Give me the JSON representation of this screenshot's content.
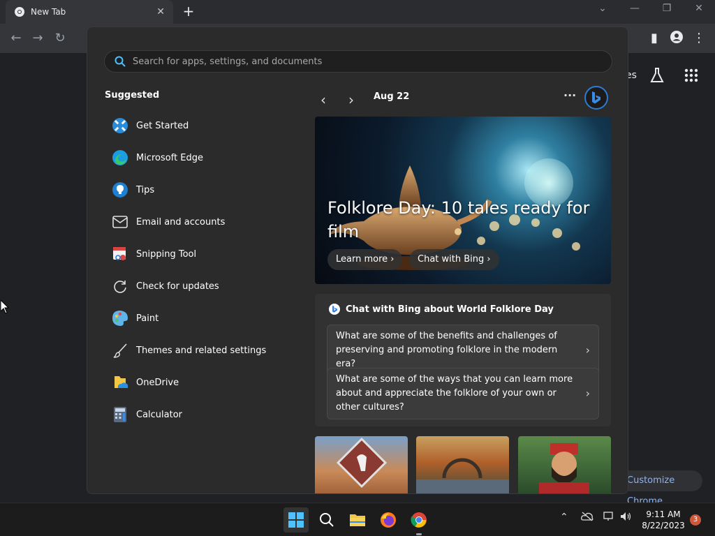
{
  "chrome": {
    "tab_title": "New Tab",
    "tab_close": "✕",
    "new_tab": "+",
    "customize_label": "Customize Chrome",
    "ntp_partial_label": "es"
  },
  "start_menu": {
    "search_placeholder": "Search for apps, settings, and documents",
    "suggested_title": "Suggested",
    "suggested": [
      {
        "label": "Get Started",
        "icon": "get-started-icon"
      },
      {
        "label": "Microsoft Edge",
        "icon": "edge-icon"
      },
      {
        "label": "Tips",
        "icon": "tips-icon"
      },
      {
        "label": "Email and accounts",
        "icon": "mail-icon"
      },
      {
        "label": "Snipping Tool",
        "icon": "snipping-tool-icon"
      },
      {
        "label": "Check for updates",
        "icon": "refresh-icon"
      },
      {
        "label": "Paint",
        "icon": "paint-icon"
      },
      {
        "label": "Themes and related settings",
        "icon": "brush-icon"
      },
      {
        "label": "OneDrive",
        "icon": "onedrive-icon"
      },
      {
        "label": "Calculator",
        "icon": "calculator-icon"
      }
    ],
    "widgets": {
      "date": "Aug 22",
      "more": "···",
      "hero_headline": "Folklore Day: 10 tales ready for film",
      "learn_more": "Learn more",
      "chat_with_bing": "Chat with Bing",
      "chat_title": "Chat with Bing about World Folklore Day",
      "questions": [
        "What are some of the benefits and challenges of preserving and promoting folklore in the modern era?",
        "What are some of the ways that you can learn more about and appreciate the folklore of your own or other cultures?"
      ]
    }
  },
  "taskbar": {
    "time": "9:11 AM",
    "date": "8/22/2023",
    "notification_count": "3"
  },
  "colors": {
    "accent": "#2d7bd6",
    "start_bg": "#2b2b2b",
    "link": "#8ab4f8"
  }
}
